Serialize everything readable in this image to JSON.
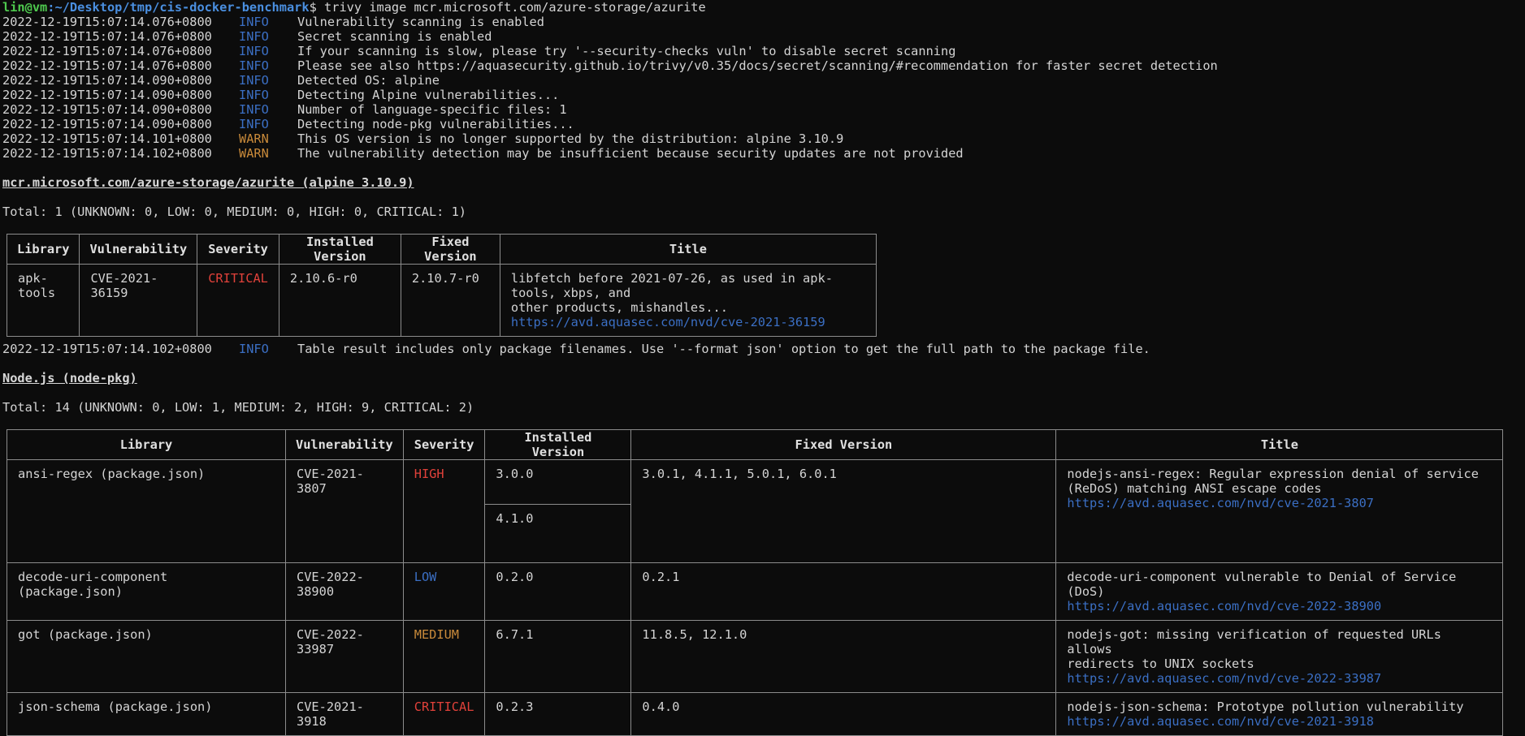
{
  "prompt": {
    "user_host": "lin@vm",
    "path": ":~/Desktop/tmp/cis-docker-benchmark",
    "dollar": "$",
    "command": " trivy image mcr.microsoft.com/azure-storage/azurite"
  },
  "log_lines": [
    {
      "ts": "2022-12-19T15:07:14.076+0800",
      "level": "INFO",
      "msg": "Vulnerability scanning is enabled"
    },
    {
      "ts": "2022-12-19T15:07:14.076+0800",
      "level": "INFO",
      "msg": "Secret scanning is enabled"
    },
    {
      "ts": "2022-12-19T15:07:14.076+0800",
      "level": "INFO",
      "msg": "If your scanning is slow, please try '--security-checks vuln' to disable secret scanning"
    },
    {
      "ts": "2022-12-19T15:07:14.076+0800",
      "level": "INFO",
      "msg": "Please see also https://aquasecurity.github.io/trivy/v0.35/docs/secret/scanning/#recommendation for faster secret detection"
    },
    {
      "ts": "2022-12-19T15:07:14.090+0800",
      "level": "INFO",
      "msg": "Detected OS: alpine"
    },
    {
      "ts": "2022-12-19T15:07:14.090+0800",
      "level": "INFO",
      "msg": "Detecting Alpine vulnerabilities..."
    },
    {
      "ts": "2022-12-19T15:07:14.090+0800",
      "level": "INFO",
      "msg": "Number of language-specific files: 1"
    },
    {
      "ts": "2022-12-19T15:07:14.090+0800",
      "level": "INFO",
      "msg": "Detecting node-pkg vulnerabilities..."
    },
    {
      "ts": "2022-12-19T15:07:14.101+0800",
      "level": "WARN",
      "msg": "This OS version is no longer supported by the distribution: alpine 3.10.9"
    },
    {
      "ts": "2022-12-19T15:07:14.102+0800",
      "level": "WARN",
      "msg": "The vulnerability detection may be insufficient because security updates are not provided"
    }
  ],
  "section1": {
    "heading": "mcr.microsoft.com/azure-storage/azurite (alpine 3.10.9)",
    "total": "Total: 1 (UNKNOWN: 0, LOW: 0, MEDIUM: 0, HIGH: 0, CRITICAL: 1)",
    "headers": [
      "Library",
      "Vulnerability",
      "Severity",
      "Installed Version",
      "Fixed Version",
      "Title"
    ],
    "row": {
      "library": "apk-tools",
      "vuln": "CVE-2021-36159",
      "severity": "CRITICAL",
      "installed": "2.10.6-r0",
      "fixed": "2.10.7-r0",
      "title1": "libfetch before 2021-07-26, as used in apk-tools, xbps, and",
      "title2": "other products, mishandles...",
      "link": "https://avd.aquasec.com/nvd/cve-2021-36159"
    }
  },
  "info_line": {
    "ts": "2022-12-19T15:07:14.102+0800",
    "level": "INFO",
    "msg": "Table result includes only package filenames. Use '--format json' option to get the full path to the package file."
  },
  "section2": {
    "heading": "Node.js (node-pkg)",
    "total": "Total: 14 (UNKNOWN: 0, LOW: 1, MEDIUM: 2, HIGH: 9, CRITICAL: 2)",
    "headers": [
      "Library",
      "Vulnerability",
      "Severity",
      "Installed Version",
      "Fixed Version",
      "Title"
    ],
    "rows": [
      {
        "library": "ansi-regex (package.json)",
        "vuln": "CVE-2021-3807",
        "severity": "HIGH",
        "installed": "3.0.0",
        "installed2": "4.1.0",
        "fixed": "3.0.1, 4.1.1, 5.0.1, 6.0.1",
        "title1": "nodejs-ansi-regex: Regular expression denial of service",
        "title2": "(ReDoS) matching ANSI escape codes",
        "link": "https://avd.aquasec.com/nvd/cve-2021-3807"
      },
      {
        "library": "decode-uri-component (package.json)",
        "vuln": "CVE-2022-38900",
        "severity": "LOW",
        "installed": "0.2.0",
        "fixed": "0.2.1",
        "title1": "decode-uri-component vulnerable to Denial of Service (DoS)",
        "link": "https://avd.aquasec.com/nvd/cve-2022-38900"
      },
      {
        "library": "got (package.json)",
        "vuln": "CVE-2022-33987",
        "severity": "MEDIUM",
        "installed": "6.7.1",
        "fixed": "11.8.5, 12.1.0",
        "title1": "nodejs-got: missing verification of requested URLs allows",
        "title2": "redirects to UNIX sockets",
        "link": "https://avd.aquasec.com/nvd/cve-2022-33987"
      },
      {
        "library": "json-schema (package.json)",
        "vuln": "CVE-2021-3918",
        "severity": "CRITICAL",
        "installed": "0.2.3",
        "fixed": "0.4.0",
        "title1": "nodejs-json-schema: Prototype pollution vulnerability",
        "link": "https://avd.aquasec.com/nvd/cve-2021-3918"
      }
    ]
  }
}
